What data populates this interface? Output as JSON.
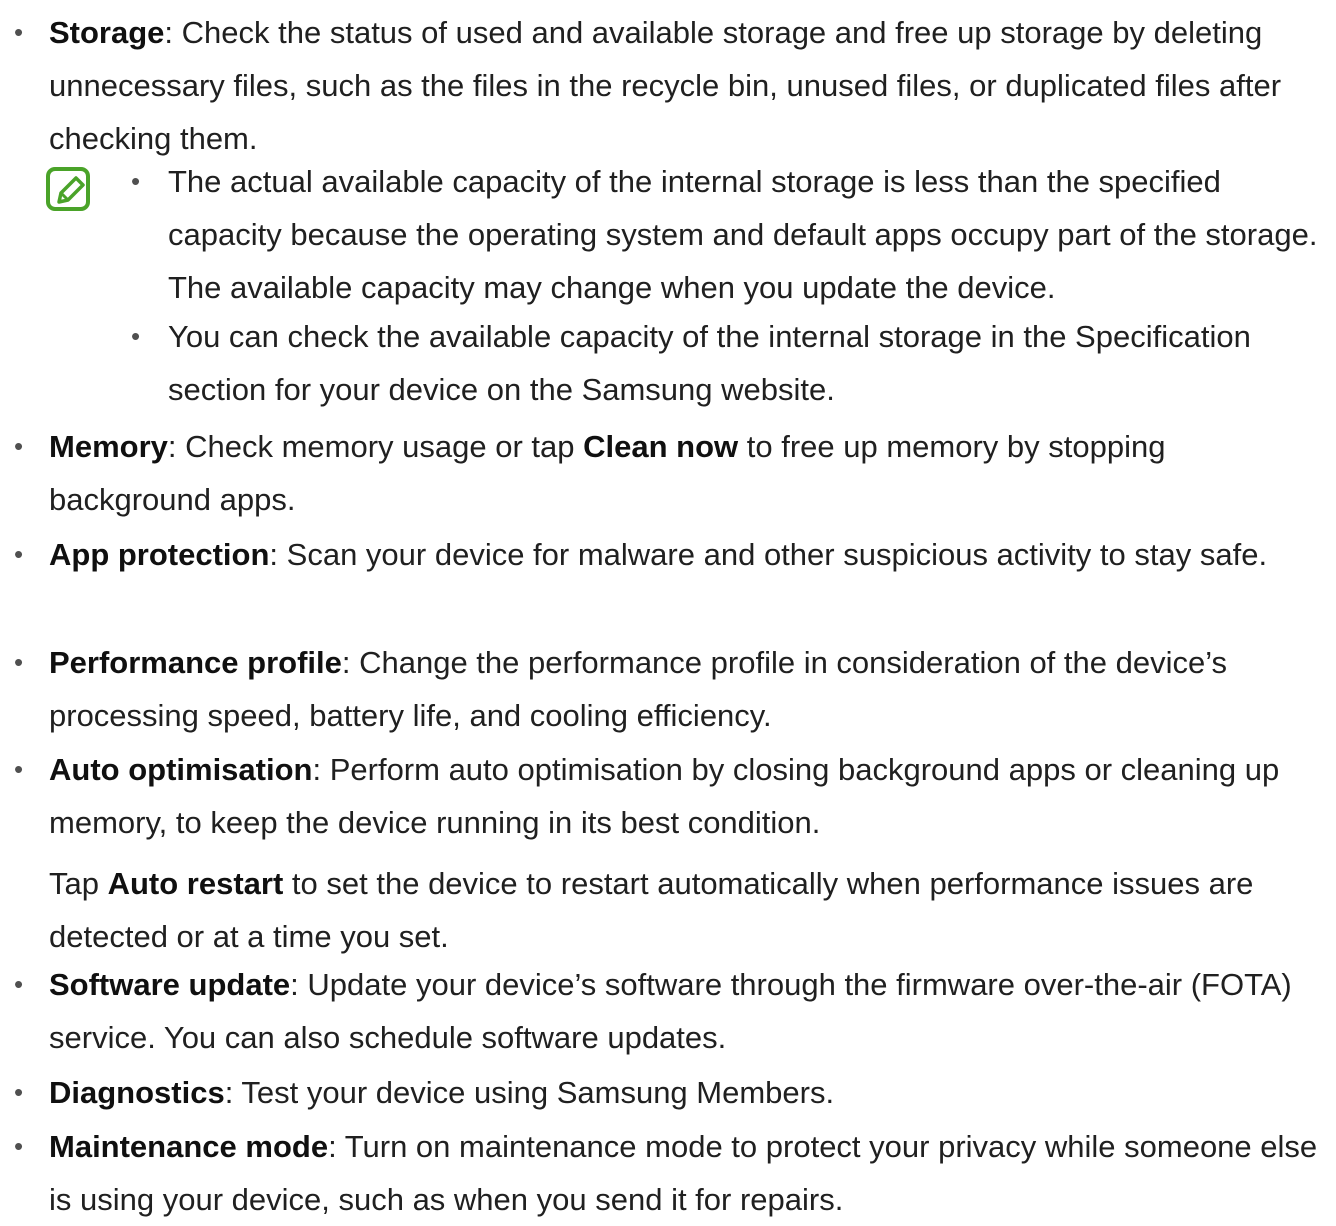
{
  "items": [
    {
      "term": "Storage",
      "desc": ": Check the status of used and available storage and free up storage by deleting unnecessary files, such as the files in the recycle bin, unused files, or duplicated files after checking them."
    },
    {
      "term": "Memory",
      "desc_a": ": Check memory usage or tap ",
      "bold": "Clean now",
      "desc_b": " to free up memory by stopping background apps."
    },
    {
      "term": "App protection",
      "desc": ": Scan your device for malware and other suspicious activity to stay safe."
    },
    {
      "term": "Performance profile",
      "desc": ": Change the performance profile in consideration of the device’s processing speed, battery life, and cooling efficiency."
    },
    {
      "term": "Auto optimisation",
      "desc": ": Perform auto optimisation by closing background apps or cleaning up memory, to keep the device running in its best condition.",
      "sub_a": "Tap ",
      "sub_bold": "Auto restart",
      "sub_b": " to set the device to restart automatically when performance issues are detected or at a time you set."
    },
    {
      "term": "Software update",
      "desc": ": Update your device’s software through the firmware over-the-air (FOTA) service. You can also schedule software updates."
    },
    {
      "term": "Diagnostics",
      "desc": ": Test your device using Samsung Members."
    },
    {
      "term": "Maintenance mode",
      "desc": ": Turn on maintenance mode to protect your privacy while someone else is using your device, such as when you send it for repairs."
    }
  ],
  "note": {
    "icon": "note-pencil-icon",
    "icon_color": "#4aa329",
    "items": [
      "The actual available capacity of the internal storage is less than the specified capacity because the operating system and default apps occupy part of the storage. The available capacity may change when you update the device.",
      "You can check the available capacity of the internal storage in the Specification section for your device on the Samsung website."
    ]
  },
  "bullet_char": "•"
}
